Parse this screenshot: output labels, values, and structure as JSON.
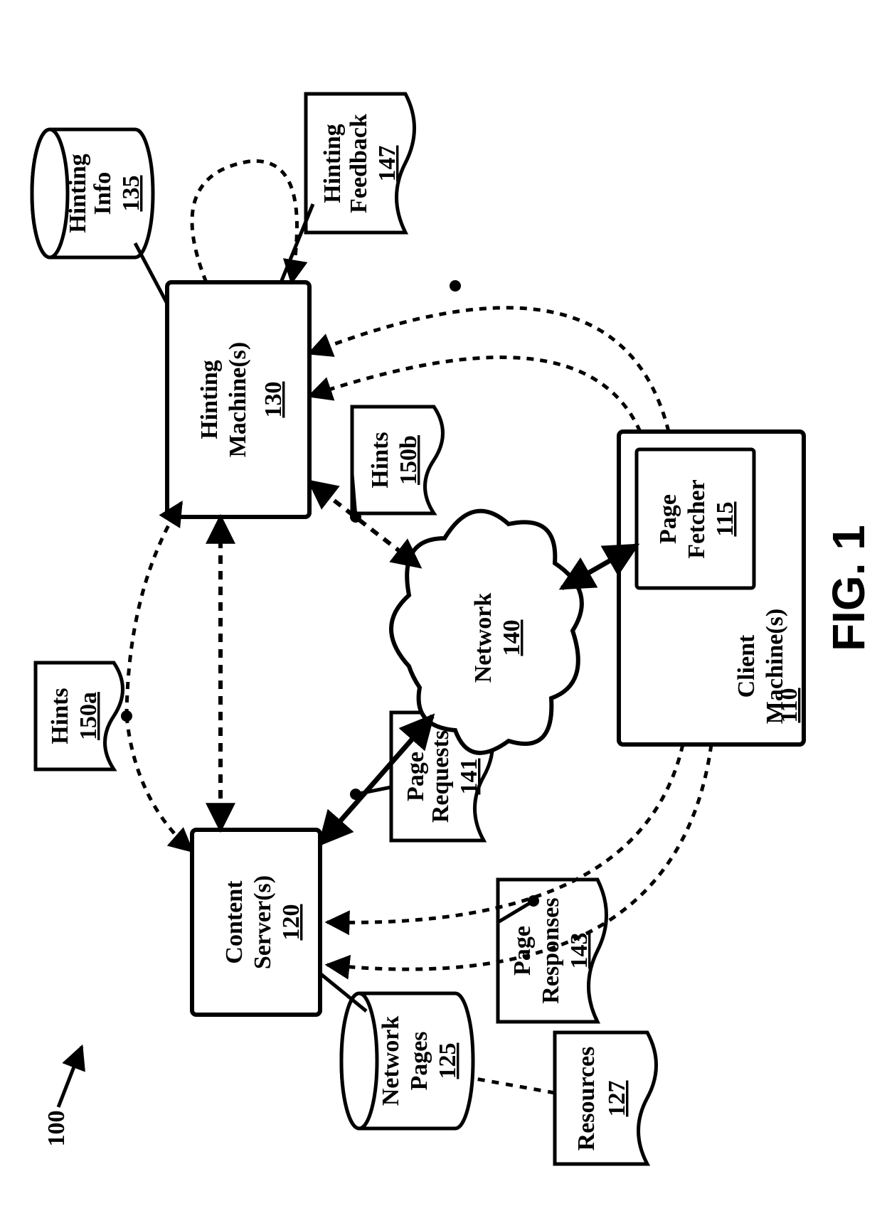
{
  "diagram_ref": "100",
  "figure_label": "FIG. 1",
  "nodes": {
    "content_server": {
      "label_line1": "Content",
      "label_line2": "Server(s)",
      "ref": "120"
    },
    "hinting_machine": {
      "label_line1": "Hinting",
      "label_line2": "Machine(s)",
      "ref": "130"
    },
    "hinting_info": {
      "label_line1": "Hinting",
      "label_line2": "Info",
      "ref": "135"
    },
    "hints_a": {
      "label": "Hints",
      "ref": "150a"
    },
    "hints_b": {
      "label": "Hints",
      "ref": "150b"
    },
    "network_pages": {
      "label_line1": "Network",
      "label_line2": "Pages",
      "ref": "125"
    },
    "resources": {
      "label": "Resources",
      "ref": "127"
    },
    "page_responses": {
      "label_line1": "Page",
      "label_line2": "Responses",
      "ref": "143"
    },
    "page_requests": {
      "label_line1": "Page",
      "label_line2": "Requests",
      "ref": "141"
    },
    "hinting_feedback": {
      "label_line1": "Hinting",
      "label_line2": "Feedback",
      "ref": "147"
    },
    "network": {
      "label": "Network",
      "ref": "140"
    },
    "client_machine": {
      "label_line1": "Client",
      "label_line2": "Machine(s)",
      "ref": "110"
    },
    "page_fetcher": {
      "label_line1": "Page",
      "label_line2": "Fetcher",
      "ref": "115"
    }
  },
  "edges": [
    {
      "from": "content_server",
      "to": "hinting_machine",
      "style": "dashed",
      "bidirectional": true
    },
    {
      "from": "hints_a",
      "to": "content_server",
      "style": "dashed"
    },
    {
      "from": "hints_a",
      "to": "hinting_machine",
      "style": "dashed"
    },
    {
      "from": "hinting_info",
      "to": "hinting_machine",
      "style": "solid"
    },
    {
      "from": "hinting_machine",
      "to": "hinting_machine",
      "style": "dashed",
      "note": "self-loop"
    },
    {
      "from": "hinting_feedback",
      "to": "hinting_machine",
      "style": "solid"
    },
    {
      "from": "content_server",
      "to": "network",
      "style": "solid",
      "bidirectional": true
    },
    {
      "from": "hinting_machine",
      "to": "network",
      "style": "dashed",
      "bidirectional": true
    },
    {
      "from": "hints_b",
      "to": "hinting_machine/network",
      "style": "solid",
      "note": "branch on dashed edge"
    },
    {
      "from": "network",
      "to": "client_machine",
      "style": "solid",
      "bidirectional": true
    },
    {
      "from": "page_requests",
      "to": "content_server/network",
      "style": "solid",
      "note": "branch on solid edge"
    },
    {
      "from": "client_machine",
      "to": "content_server",
      "style": "dashed",
      "count": 2
    },
    {
      "from": "page_responses",
      "to": "client_machine/content_server",
      "style": "solid",
      "note": "branch on dashed edge"
    },
    {
      "from": "client_machine",
      "to": "hinting_machine",
      "style": "dashed",
      "count": 2
    },
    {
      "from": "hinting_feedback",
      "to": "client_machine/hinting_machine",
      "style": "solid",
      "note": "branch on dashed edge"
    },
    {
      "from": "network_pages",
      "to": "content_server",
      "style": "solid"
    },
    {
      "from": "resources",
      "to": "network_pages",
      "style": "dashed"
    }
  ]
}
